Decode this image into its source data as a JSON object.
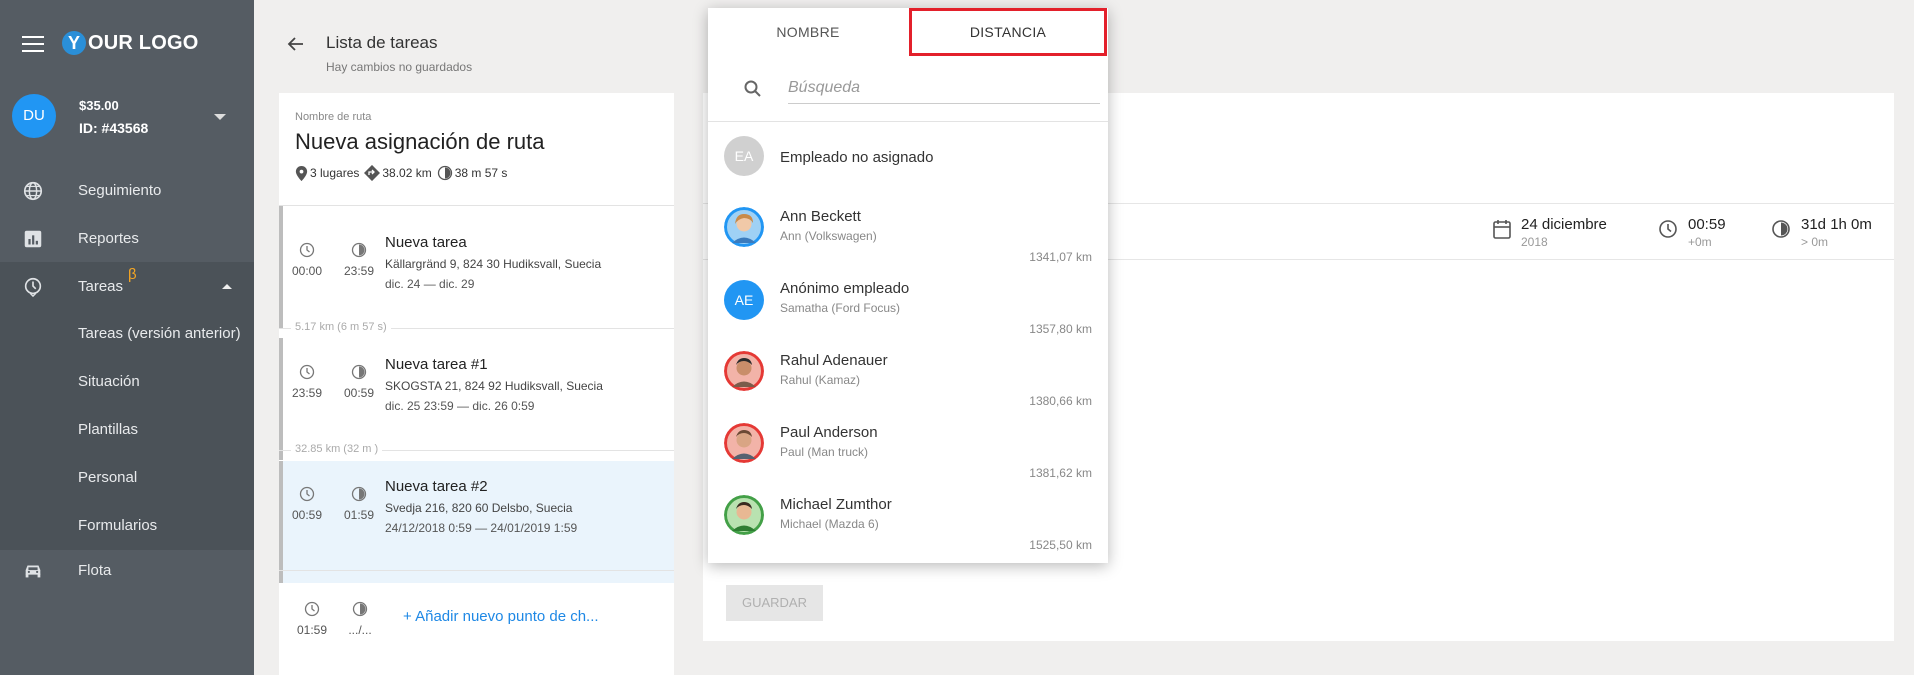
{
  "logo": {
    "letter": "Y",
    "text": "OUR LOGO"
  },
  "user": {
    "initials": "DU",
    "balance": "$35.00",
    "id": "ID: #43568"
  },
  "sidebar": {
    "items": [
      {
        "label": "Seguimiento",
        "icon": "globe-icon"
      },
      {
        "label": "Reportes",
        "icon": "chart-icon"
      },
      {
        "label": "Tareas",
        "icon": "clock-icon",
        "badge": "β"
      }
    ],
    "subitems": [
      {
        "label": "Tareas (versión anterior)"
      },
      {
        "label": "Situación"
      },
      {
        "label": "Plantillas"
      },
      {
        "label": "Personal"
      },
      {
        "label": "Formularios"
      }
    ],
    "fleet": {
      "label": "Flota",
      "icon": "car-icon"
    }
  },
  "header": {
    "title": "Lista de tareas",
    "subtitle": "Hay cambios no guardados"
  },
  "route": {
    "label": "Nombre de ruta",
    "name": "Nueva asignación de ruta",
    "places": "3 lugares",
    "distance": "38.02 km",
    "duration": "38 m 57 s"
  },
  "tasks": [
    {
      "start": "00:00",
      "end": "23:59",
      "title": "Nueva tarea",
      "address": "Källargränd 9, 824 30 Hudiksvall, Suecia",
      "dates": "dic. 24 — dic. 29"
    },
    {
      "start": "23:59",
      "end": "00:59",
      "title": "Nueva tarea #1",
      "address": "SKOGSTA 21, 824 92 Hudiksvall, Suecia",
      "dates": "dic. 25 23:59 — dic. 26 0:59"
    },
    {
      "start": "00:59",
      "end": "01:59",
      "title": "Nueva tarea #2",
      "address": "Svedja 216, 820 60 Delsbo, Suecia",
      "dates": "24/12/2018 0:59 — 24/01/2019 1:59"
    }
  ],
  "gaps": [
    "5.17 km (6 m 57 s)",
    "32.85 km (32 m )"
  ],
  "add_point": {
    "start": "01:59",
    "end": ".../...",
    "label": "+ Añadir nuevo punto de ch..."
  },
  "meta": {
    "date": "24 diciembre",
    "year": "2018",
    "time": "00:59",
    "time_sub": "+0m",
    "duration": "31d 1h 0m",
    "duration_sub": "> 0m"
  },
  "save_label": "GUARDAR",
  "dropdown": {
    "tabs": [
      "NOMBRE",
      "DISTANCIA"
    ],
    "active_tab": 1,
    "search_placeholder": "Búsqueda",
    "unassigned": {
      "initials": "EA",
      "label": "Empleado no asignado"
    },
    "employees": [
      {
        "name": "Ann Beckett",
        "vehicle": "Ann (Volkswagen)",
        "distance": "1341,07 km",
        "avatar": "photo",
        "ring": "#2196f3"
      },
      {
        "name": "Anónimo empleado",
        "vehicle": "Samatha (Ford Focus)",
        "distance": "1357,80 km",
        "avatar": "initials",
        "initials": "AE",
        "ring": "#2196f3"
      },
      {
        "name": "Rahul Adenauer",
        "vehicle": "Rahul (Kamaz)",
        "distance": "1380,66 km",
        "avatar": "photo",
        "ring": "#e53935"
      },
      {
        "name": "Paul Anderson",
        "vehicle": "Paul (Man truck)",
        "distance": "1381,62 km",
        "avatar": "photo",
        "ring": "#e53935"
      },
      {
        "name": "Michael Zumthor",
        "vehicle": "Michael (Mazda 6)",
        "distance": "1525,50 km",
        "avatar": "photo",
        "ring": "#43a047"
      }
    ]
  },
  "colors": {
    "sidebar": "#555c63",
    "accent": "#2196f3",
    "active_tab_border": "#e3202b",
    "link": "#1e88e5"
  }
}
